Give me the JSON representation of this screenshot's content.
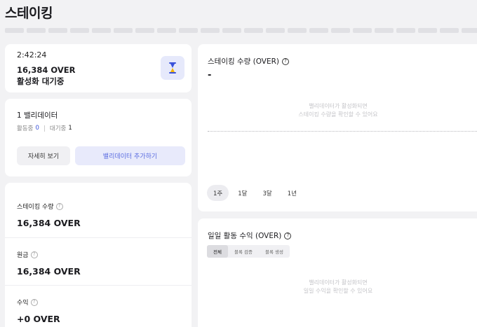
{
  "page": {
    "title": "스테이킹"
  },
  "status": {
    "time": "2:42:24",
    "amount": "16,384 OVER",
    "label": "활성화 대기중",
    "icon": "hourglass-icon",
    "accent": "#3a52d9"
  },
  "validator": {
    "title": "1 밸리데이터",
    "active_label": "활동중",
    "active_count": "0",
    "waiting_label": "대기중",
    "waiting_count": "1",
    "detail_button": "자세히 보기",
    "add_button": "밸리데이터 추가하기"
  },
  "stats": [
    {
      "label": "스테이킹 수량",
      "value": "16,384 OVER"
    },
    {
      "label": "원금",
      "value": "16,384 OVER"
    },
    {
      "label": "수익",
      "value": "+0 OVER"
    }
  ],
  "staking_chart": {
    "title": "스테이킹 수량 (OVER)",
    "value": "-",
    "empty_line1": "밸리데이터가 활성화되면",
    "empty_line2": "스테이킹 수량을 확인할 수 있어요",
    "ranges": [
      "1주",
      "1달",
      "3달",
      "1년"
    ],
    "selected_range": "1주"
  },
  "reward_chart": {
    "title": "일일 활동 수익 (OVER)",
    "tabs": [
      "전체",
      "블록 검증",
      "블록 생성"
    ],
    "selected_tab": "전체",
    "empty_line1": "밸리데이터가 활성화되면",
    "empty_line2": "일일 수익을 확인할 수 있어요"
  }
}
